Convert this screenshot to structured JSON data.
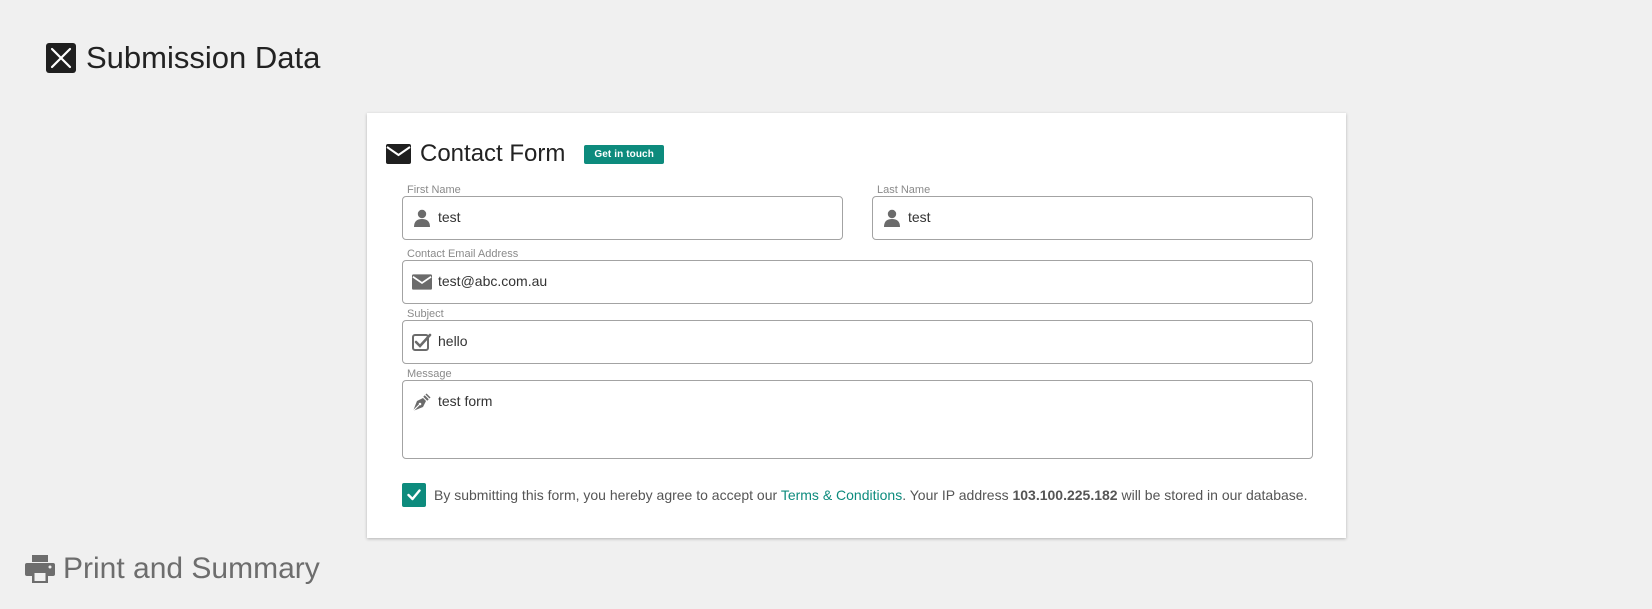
{
  "page": {
    "title": "Submission Data",
    "print_section_title": "Print and Summary"
  },
  "form": {
    "title": "Contact Form",
    "badge": "Get in touch",
    "fields": {
      "first_name": {
        "label": "First Name",
        "value": "test",
        "icon": "user-icon"
      },
      "last_name": {
        "label": "Last Name",
        "value": "test",
        "icon": "user-icon"
      },
      "email": {
        "label": "Contact Email Address",
        "value": "test@abc.com.au",
        "icon": "envelope-icon"
      },
      "subject": {
        "label": "Subject",
        "value": "hello",
        "icon": "check-square-icon"
      },
      "message": {
        "label": "Message",
        "value": "test form",
        "icon": "pen-nib-icon"
      }
    },
    "consent": {
      "checked": true,
      "text_before": "By submitting this form, you hereby agree to accept our ",
      "link_text": "Terms & Conditions",
      "text_middle": ". Your IP address ",
      "ip_address": "103.100.225.182",
      "text_after": " will be stored in our database."
    }
  },
  "colors": {
    "accent": "#0d8b7d",
    "background": "#f0f0f0",
    "border": "#a3a3a3",
    "label": "#8a8a8a"
  }
}
